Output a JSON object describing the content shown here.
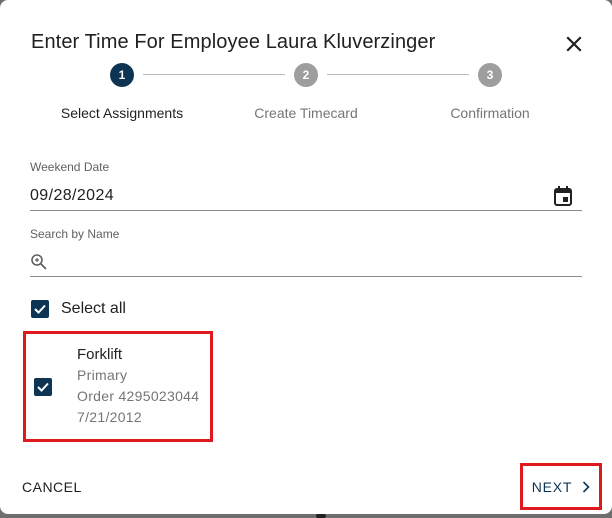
{
  "dialog": {
    "title": "Enter Time For Employee Laura Kluverzinger",
    "close_icon": "close-icon"
  },
  "stepper": {
    "steps": [
      {
        "number": "1",
        "label": "Select Assignments",
        "state": "active"
      },
      {
        "number": "2",
        "label": "Create Timecard",
        "state": "inactive"
      },
      {
        "number": "3",
        "label": "Confirmation",
        "state": "inactive"
      }
    ]
  },
  "form": {
    "weekend_date": {
      "label": "Weekend Date",
      "value": "09/28/2024",
      "icon": "calendar-icon"
    },
    "search": {
      "label": "Search by Name",
      "placeholder": "",
      "value": "",
      "icon": "search-icon"
    },
    "select_all": {
      "label": "Select all",
      "checked": true
    }
  },
  "assignments": [
    {
      "title": "Forklift",
      "type": "Primary",
      "order": "Order 4295023044",
      "date": "7/21/2012",
      "checked": true
    }
  ],
  "footer": {
    "cancel_label": "CANCEL",
    "next_label": "NEXT",
    "next_icon": "chevron-right-icon"
  },
  "colors": {
    "accent": "#0d3553",
    "highlight_border": "#e0191e",
    "inactive_step": "#9e9e9e"
  }
}
